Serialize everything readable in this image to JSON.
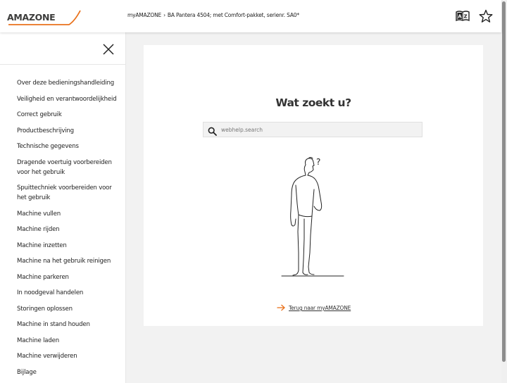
{
  "header": {
    "logo_text": "AMAZONE",
    "breadcrumb": [
      {
        "label": "myAMAZONE"
      },
      {
        "label": "BA Pantera 4504; met Comfort-pakket, serienr. SA0*"
      }
    ],
    "breadcrumb_separator": "›",
    "icons": [
      "language-icon",
      "star-icon"
    ]
  },
  "sidebar": {
    "close_icon": "close-icon",
    "items": [
      {
        "label": "Over deze bedieningshandleiding"
      },
      {
        "label": "Veiligheid en verantwoordelijkheid"
      },
      {
        "label": "Correct gebruik"
      },
      {
        "label": "Productbeschrijving"
      },
      {
        "label": "Technische gegevens"
      },
      {
        "label": "Dragende voertuig voorbereiden voor het gebruik"
      },
      {
        "label": "Spuittechniek voorbereiden voor het gebruik"
      },
      {
        "label": "Machine vullen"
      },
      {
        "label": "Machine rijden"
      },
      {
        "label": "Machine inzetten"
      },
      {
        "label": "Machine na het gebruik reinigen"
      },
      {
        "label": "Machine parkeren"
      },
      {
        "label": "In noodgeval handelen"
      },
      {
        "label": "Storingen oplossen"
      },
      {
        "label": "Machine in stand houden"
      },
      {
        "label": "Machine laden"
      },
      {
        "label": "Machine verwijderen"
      },
      {
        "label": "Bijlage"
      }
    ]
  },
  "main": {
    "title": "Wat zoekt u?",
    "search": {
      "placeholder": "webhelp.search",
      "value": "",
      "icon": "search-icon"
    },
    "illustration": "confused-person-illustration",
    "question_mark": "?",
    "back_link": {
      "label": "Terug naar myAMAZONE",
      "icon": "arrow-right-icon"
    }
  },
  "colors": {
    "accent": "#e9721c",
    "background": "#f2f2f2",
    "panel": "#ffffff",
    "text": "#222222"
  }
}
